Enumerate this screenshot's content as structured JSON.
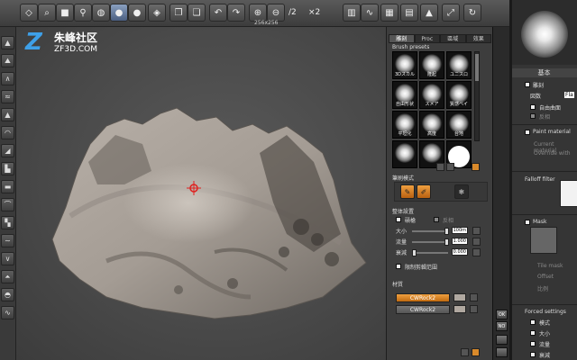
{
  "toolbar": {
    "texts": {
      "half": "/2",
      "double": "×2",
      "size_readout": "256x256"
    },
    "icons": [
      "select-icon",
      "zoom-lens-icon",
      "square-icon",
      "globe-pin-icon",
      "globe-icon",
      "sphere-active-icon",
      "sphere-icon",
      "landscape-icon",
      "copy-icon",
      "paste-icon",
      "undo-icon",
      "redo-icon",
      "zoom-in-icon",
      "zoom-out-icon",
      "histogram-icon",
      "wave-icon",
      "grid-icon",
      "wireframe-icon",
      "terrain-icon",
      "fit-icon",
      "refresh-icon"
    ]
  },
  "logo": {
    "chinese": "朱峰社区",
    "english": "ZF3D.COM",
    "mark": "Z"
  },
  "panel": {
    "tabs": [
      {
        "label": "雕刻",
        "active": true
      },
      {
        "label": "Proc",
        "active": false
      },
      {
        "label": "區域",
        "active": false
      },
      {
        "label": "效果",
        "active": false
      }
    ],
    "brush_presets_title": "Brush presets",
    "brushes": [
      {
        "label": "3Dスカル",
        "hard": false
      },
      {
        "label": "隆起",
        "hard": false
      },
      {
        "label": "ユニスロ",
        "hard": false
      },
      {
        "label": "自由形状",
        "hard": false
      },
      {
        "label": "スメア",
        "hard": false
      },
      {
        "label": "質感ベイ",
        "hard": false
      },
      {
        "label": "平坦化",
        "hard": false
      },
      {
        "label": "高度",
        "hard": false
      },
      {
        "label": "台地",
        "hard": false
      },
      {
        "label": "",
        "hard": false
      },
      {
        "label": "",
        "hard": false
      },
      {
        "label": "",
        "hard": true
      }
    ],
    "stroke_mode_title": "筆刷模式",
    "global_settings_title": "整体設置",
    "carve_label": "磧槍",
    "reverse_label": "反相",
    "size_label": "大小",
    "size_value": "100m",
    "flow_label": "流量",
    "flow_value": "1.000",
    "falloff_label": "衰減",
    "falloff_value": "0.000",
    "limit_label": "限制剪輯范圍",
    "material_title": "材質",
    "materials": [
      "CWRock2",
      "CWRock2"
    ]
  },
  "vstrip": {
    "ok": "OK",
    "no": "NO"
  },
  "right_panel": {
    "basic_title": "基本",
    "carve": "雕刻",
    "layer": "図数",
    "layer_value": "Fla",
    "freeform": "自由曲面",
    "reverse": "反相",
    "paint_material": "Paint material",
    "current_material": "Current material",
    "override_with": "Override with",
    "falloff_filter": "Falloff filter",
    "mask": "Mask",
    "tile_mask": "Tile mask",
    "offset": "Offset",
    "ratio": "比例",
    "forced_settings": "Forced settings",
    "mode": "模式",
    "size": "大小",
    "flow": "流量",
    "falloff": "衰減"
  }
}
